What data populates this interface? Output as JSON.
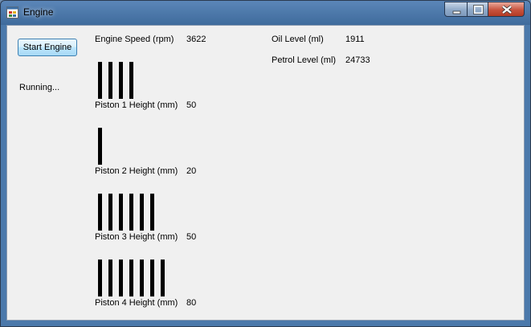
{
  "window": {
    "title": "Engine"
  },
  "controls": {
    "start_label": "Start Engine",
    "status": "Running..."
  },
  "engine": {
    "speed_label": "Engine Speed (rpm)",
    "speed_value": "3622",
    "oil_label": "Oil Level (ml)",
    "oil_value": "1911",
    "petrol_label": "Petrol Level (ml)",
    "petrol_value": "24733"
  },
  "pistons": [
    {
      "label": "Piston 1 Height (mm)",
      "value": "50",
      "bars": 4
    },
    {
      "label": "Piston 2 Height (mm)",
      "value": "20",
      "bars": 1
    },
    {
      "label": "Piston 3 Height (mm)",
      "value": "50",
      "bars": 6
    },
    {
      "label": "Piston 4 Height (mm)",
      "value": "80",
      "bars": 7
    }
  ]
}
